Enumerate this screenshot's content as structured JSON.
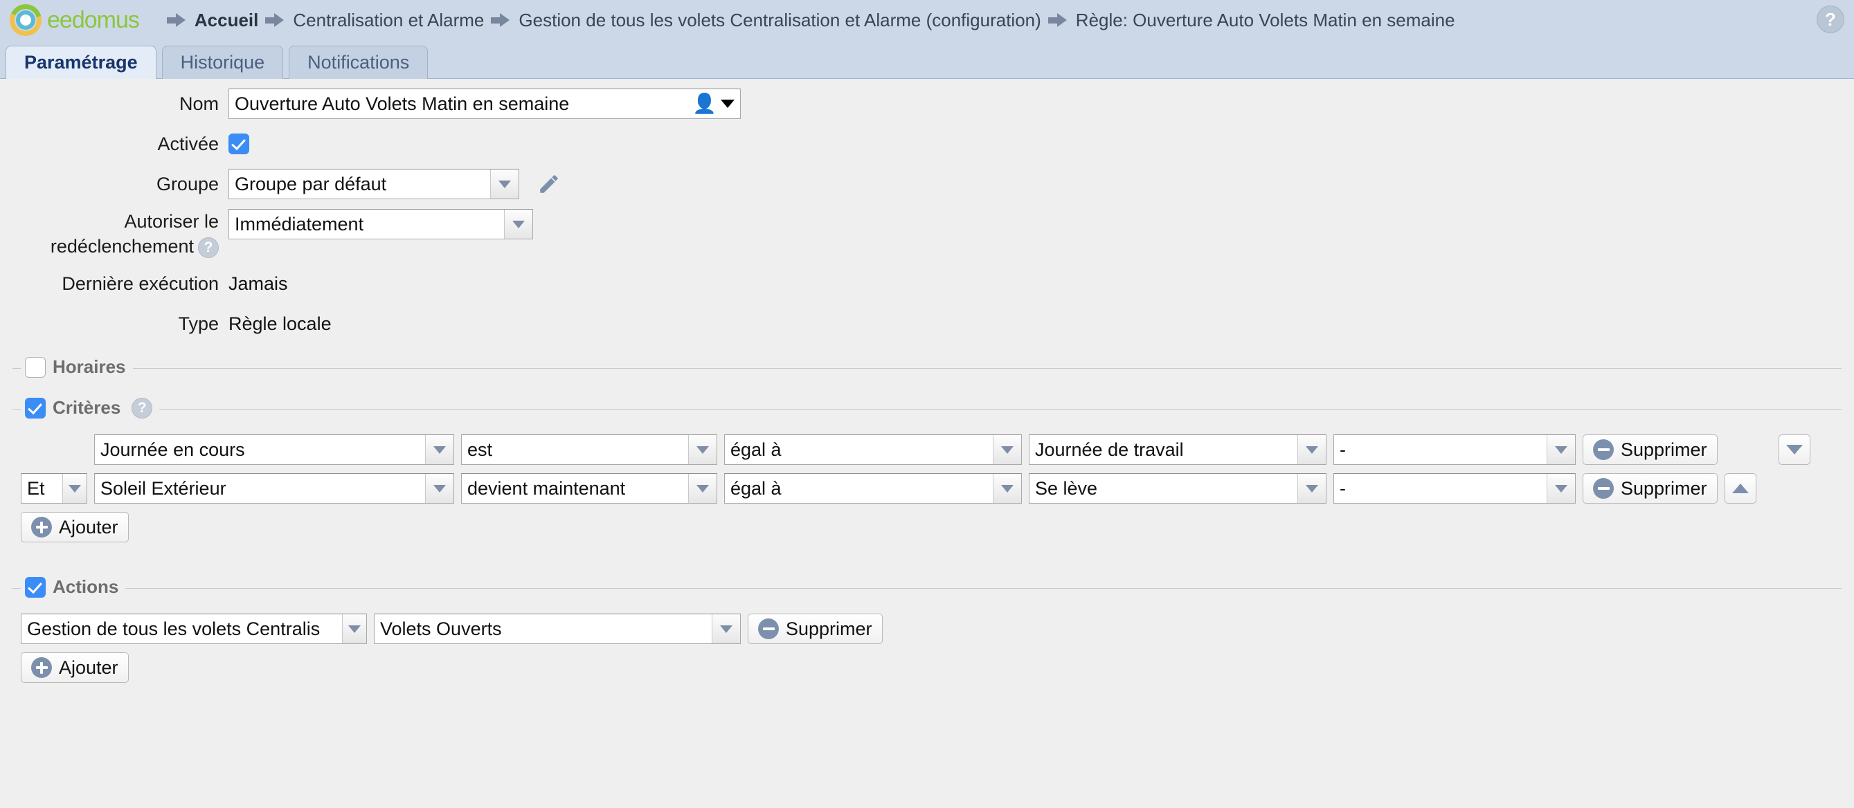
{
  "brand": {
    "name": "eedomus",
    "logo_icon": "eedomus-ring-logo"
  },
  "breadcrumb": {
    "items": [
      {
        "label": "Accueil",
        "icon": "arrow-right-icon"
      },
      {
        "label": "Centralisation et Alarme",
        "icon": "arrow-right-icon"
      },
      {
        "label": "Gestion de tous les volets Centralisation et Alarme (configuration)",
        "icon": "arrow-right-icon"
      },
      {
        "label": "Règle: Ouverture Auto Volets Matin en semaine",
        "icon": "arrow-right-icon"
      }
    ]
  },
  "header": {
    "help_icon": "question-mark-icon",
    "help_label": "?"
  },
  "tabs": [
    {
      "label": "Paramétrage",
      "active": true
    },
    {
      "label": "Historique",
      "active": false
    },
    {
      "label": "Notifications",
      "active": false
    }
  ],
  "form": {
    "nom": {
      "label": "Nom",
      "value": "Ouverture Auto Volets Matin en semaine",
      "icon": "person-icon"
    },
    "activee": {
      "label": "Activée",
      "checked": true
    },
    "groupe": {
      "label": "Groupe",
      "value": "Groupe par défaut",
      "edit_icon": "pencil-icon"
    },
    "redeclenchement": {
      "label_line1": "Autoriser le",
      "label_line2": "redéclenchement",
      "help": "?",
      "value": "Immédiatement"
    },
    "derniere_execution": {
      "label": "Dernière exécution",
      "value": "Jamais"
    },
    "type": {
      "label": "Type",
      "value": "Règle locale"
    }
  },
  "horaires": {
    "legend": "Horaires",
    "checked": false
  },
  "criteres": {
    "legend": "Critères",
    "checked": true,
    "help": "?",
    "add_label": "Ajouter",
    "delete_label": "Supprimer",
    "rows": [
      {
        "conjunction": "",
        "subject": "Journée en cours",
        "operator": "est",
        "comparator": "égal à",
        "value": "Journée de travail",
        "extra": "-",
        "delete_label": "Supprimer",
        "move_icon": "triangle-down-icon"
      },
      {
        "conjunction": "Et",
        "subject": "Soleil Extérieur",
        "operator": "devient maintenant",
        "comparator": "égal à",
        "value": "Se lève",
        "extra": "-",
        "delete_label": "Supprimer",
        "move_icon": "triangle-up-icon"
      }
    ]
  },
  "actions": {
    "legend": "Actions",
    "checked": true,
    "add_label": "Ajouter",
    "rows": [
      {
        "target": "Gestion de tous les volets Centralis",
        "command": "Volets Ouverts",
        "delete_label": "Supprimer"
      }
    ]
  },
  "colors": {
    "topbar_bg": "#ccd8e8",
    "page_bg": "#efefef",
    "accent_blue": "#3b8cf5",
    "icon_blue_grey": "#7c90ad",
    "logo_green": "#8cc63f",
    "logo_yellow": "#f0c24b",
    "logo_cyan": "#5bb9d4"
  }
}
